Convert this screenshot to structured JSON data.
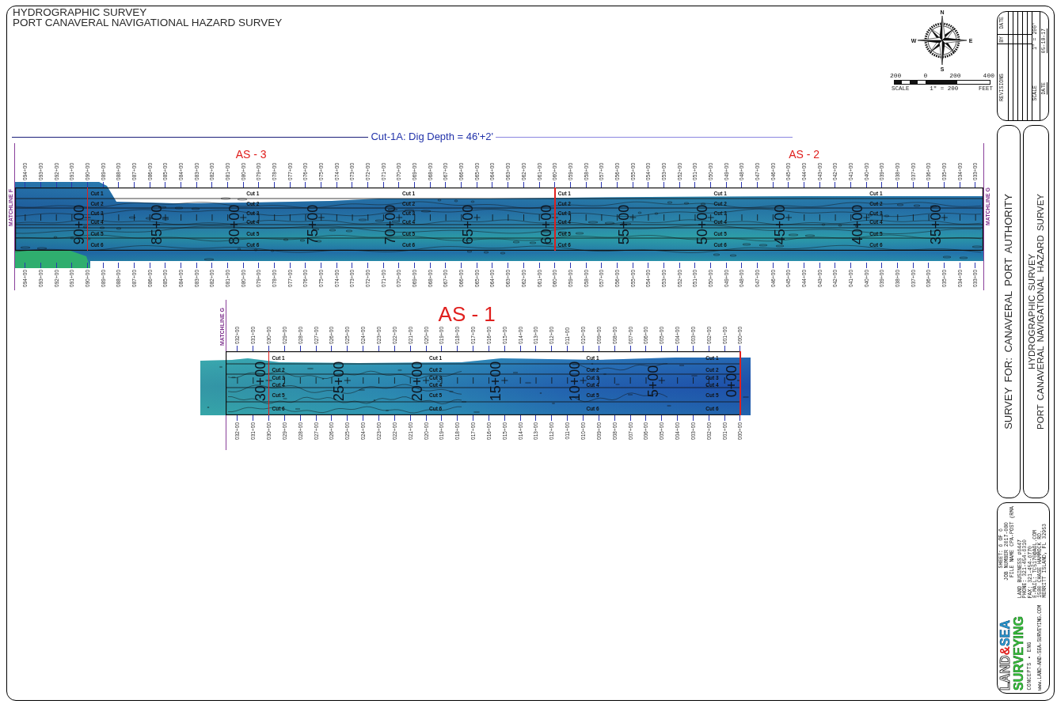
{
  "title": {
    "lines": [
      "HYDROGRAPHIC SURVEY",
      "PORT CANAVERAL NAVIGATIONAL HAZARD SURVEY"
    ]
  },
  "compass": {
    "letters": [
      "N",
      "E",
      "S",
      "W"
    ]
  },
  "scale_bar": {
    "ticks": [
      "200",
      "0",
      "200",
      "400"
    ],
    "label": "SCALE",
    "ratio": "1\" = 200",
    "unit": "FEET"
  },
  "cut_header": {
    "text": "Cut-1A: Dig Depth = 46'+2'"
  },
  "upper_strip": {
    "matchline_left": "MATCHLINE F",
    "matchline_right": "MATCHLINE G",
    "area_labels": [
      "AS - 3",
      "AS - 2"
    ],
    "stations_top": [
      "094+00",
      "093+00",
      "092+00",
      "091+00",
      "090+00",
      "089+00",
      "088+00",
      "087+00",
      "086+00",
      "085+00",
      "084+00",
      "083+00",
      "082+00",
      "081+00",
      "080+00",
      "079+00",
      "078+00",
      "077+00",
      "076+00",
      "075+00",
      "074+00",
      "073+00",
      "072+00",
      "071+00",
      "070+00",
      "069+00",
      "068+00",
      "067+00",
      "066+00",
      "065+00",
      "064+00",
      "063+00",
      "062+00",
      "061+00",
      "060+00",
      "059+00",
      "058+00",
      "057+00",
      "056+00",
      "055+00",
      "054+00",
      "053+00",
      "052+00",
      "051+00",
      "050+00",
      "049+00",
      "048+00",
      "047+00",
      "046+00",
      "045+00",
      "044+00",
      "043+00",
      "042+00",
      "041+00",
      "040+00",
      "039+00",
      "038+00",
      "037+00",
      "036+00",
      "035+00",
      "034+00",
      "033+00"
    ],
    "stations_bottom": [
      "094+00",
      "093+00",
      "092+00",
      "091+00",
      "090+00",
      "089+00",
      "088+00",
      "087+00",
      "086+00",
      "085+00",
      "084+00",
      "083+00",
      "082+00",
      "081+00",
      "080+00",
      "079+00",
      "078+00",
      "077+00",
      "076+00",
      "075+00",
      "074+00",
      "073+00",
      "072+00",
      "071+00",
      "070+00",
      "069+00",
      "068+00",
      "067+00",
      "066+00",
      "065+00",
      "064+00",
      "063+00",
      "062+00",
      "061+00",
      "060+00",
      "059+00",
      "058+00",
      "057+00",
      "056+00",
      "055+00",
      "054+00",
      "053+00",
      "052+00",
      "051+00",
      "050+00",
      "049+00",
      "048+00",
      "047+00",
      "046+00",
      "045+00",
      "044+00",
      "043+00",
      "042+00",
      "041+00",
      "040+00",
      "039+00",
      "038+00",
      "037+00",
      "036+00",
      "035+00",
      "034+00",
      "033+00"
    ],
    "major_stations": [
      "90+00",
      "85+00",
      "80+00",
      "75+00",
      "70+00",
      "65+00",
      "60+00",
      "55+00",
      "50+00",
      "45+00",
      "40+00",
      "35+00"
    ],
    "cut_columns": [
      [
        "Cut 1",
        "Cut 2",
        "Cut 3",
        "Cut 4",
        "Cut 5",
        "Cut 6"
      ],
      [
        "Cut 1",
        "Cut 2",
        "Cut 3",
        "Cut 4",
        "Cut 5",
        "Cut 6"
      ],
      [
        "Cut 1",
        "Cut 2",
        "Cut 3",
        "Cut 4",
        "Cut 5",
        "Cut 6"
      ],
      [
        "Cut 1",
        "Cut 2",
        "Cut 3",
        "Cut 4",
        "Cut 5",
        "Cut 6"
      ],
      [
        "Cut 1",
        "Cut 2",
        "Cut 3",
        "Cut 4",
        "Cut 5",
        "Cut 6"
      ],
      [
        "Cut 1",
        "Cut 2",
        "Cut 3",
        "Cut 4",
        "Cut 5",
        "Cut 6"
      ]
    ]
  },
  "lower_strip": {
    "matchline_left": "MATCHLINE G",
    "area_labels": [
      "AS - 1"
    ],
    "stations_top": [
      "032+00",
      "031+00",
      "030+00",
      "029+00",
      "028+00",
      "027+00",
      "026+00",
      "025+00",
      "024+00",
      "023+00",
      "022+00",
      "021+00",
      "020+00",
      "019+00",
      "018+00",
      "017+00",
      "016+00",
      "015+00",
      "014+00",
      "013+00",
      "012+00",
      "011+00",
      "010+00",
      "009+00",
      "008+00",
      "007+00",
      "006+00",
      "005+00",
      "004+00",
      "003+00",
      "002+00",
      "001+00",
      "000+00"
    ],
    "stations_bottom": [
      "032+00",
      "031+00",
      "030+00",
      "029+00",
      "028+00",
      "027+00",
      "026+00",
      "025+00",
      "024+00",
      "023+00",
      "022+00",
      "021+00",
      "020+00",
      "019+00",
      "018+00",
      "017+00",
      "016+00",
      "015+00",
      "014+00",
      "013+00",
      "012+00",
      "011+00",
      "010+00",
      "009+00",
      "008+00",
      "007+00",
      "006+00",
      "005+00",
      "004+00",
      "003+00",
      "002+00",
      "001+00",
      "000+00"
    ],
    "major_stations": [
      "30+00",
      "25+00",
      "20+00",
      "15+00",
      "10+00",
      "5+00",
      "0+00"
    ],
    "cut_columns": [
      [
        "Cut 1",
        "Cut 2",
        "Cut 3",
        "Cut 4",
        "Cut 5",
        "Cut 6"
      ],
      [
        "Cut 1",
        "Cut 2",
        "Cut 3",
        "Cut 4",
        "Cut 5",
        "Cut 6"
      ],
      [
        "Cut 1",
        "Cut 2",
        "Cut 3",
        "Cut 4",
        "Cut 5",
        "Cut 6"
      ],
      [
        "Cut 1",
        "Cut 2",
        "Cut 3",
        "Cut 4",
        "Cut 5",
        "Cut 6"
      ]
    ]
  },
  "title_block": {
    "revisions": {
      "date_header": "DATE",
      "by_header": "BY",
      "label": "REVISIONS",
      "scale_value": "1\" = 200'",
      "scale_label": "SCALE",
      "date_value": "05-18-17",
      "date_label": "DATE"
    },
    "client": "SURVEY FOR: CANAVERAL PORT AUTHORITY",
    "project": [
      "HYDROGRAPHIC SURVEY",
      "PORT CANAVERAL NAVIGATIONAL HAZARD SURVEY"
    ],
    "company": {
      "sheet_fields": [
        {
          "label": "SHEET:",
          "value": "6 OF 6"
        },
        {
          "label": "JOB NUMBER",
          "value": "2017-080"
        },
        {
          "label": "FILE NAME",
          "value": "CPA-POST (RMA"
        }
      ],
      "address_lines": [
        "LAND BUSINESS #6447",
        "PHONE: 321-454-6310",
        "FAX: 321-454-6770",
        "E-MAIL: TC5170@AOL.COM",
        "1580 CHASE HAMMOCK RD.",
        "MERRITT ISLAND, FL 32953"
      ],
      "logo": {
        "word_left": "LAND",
        "ampersand": "&",
        "word_right": "SEA",
        "word_bottom": "SURVEYING"
      },
      "tagline": "CONCEPTS • ENG",
      "website": "www.LAND-AND-SEA-SURVEYING.COM"
    }
  }
}
